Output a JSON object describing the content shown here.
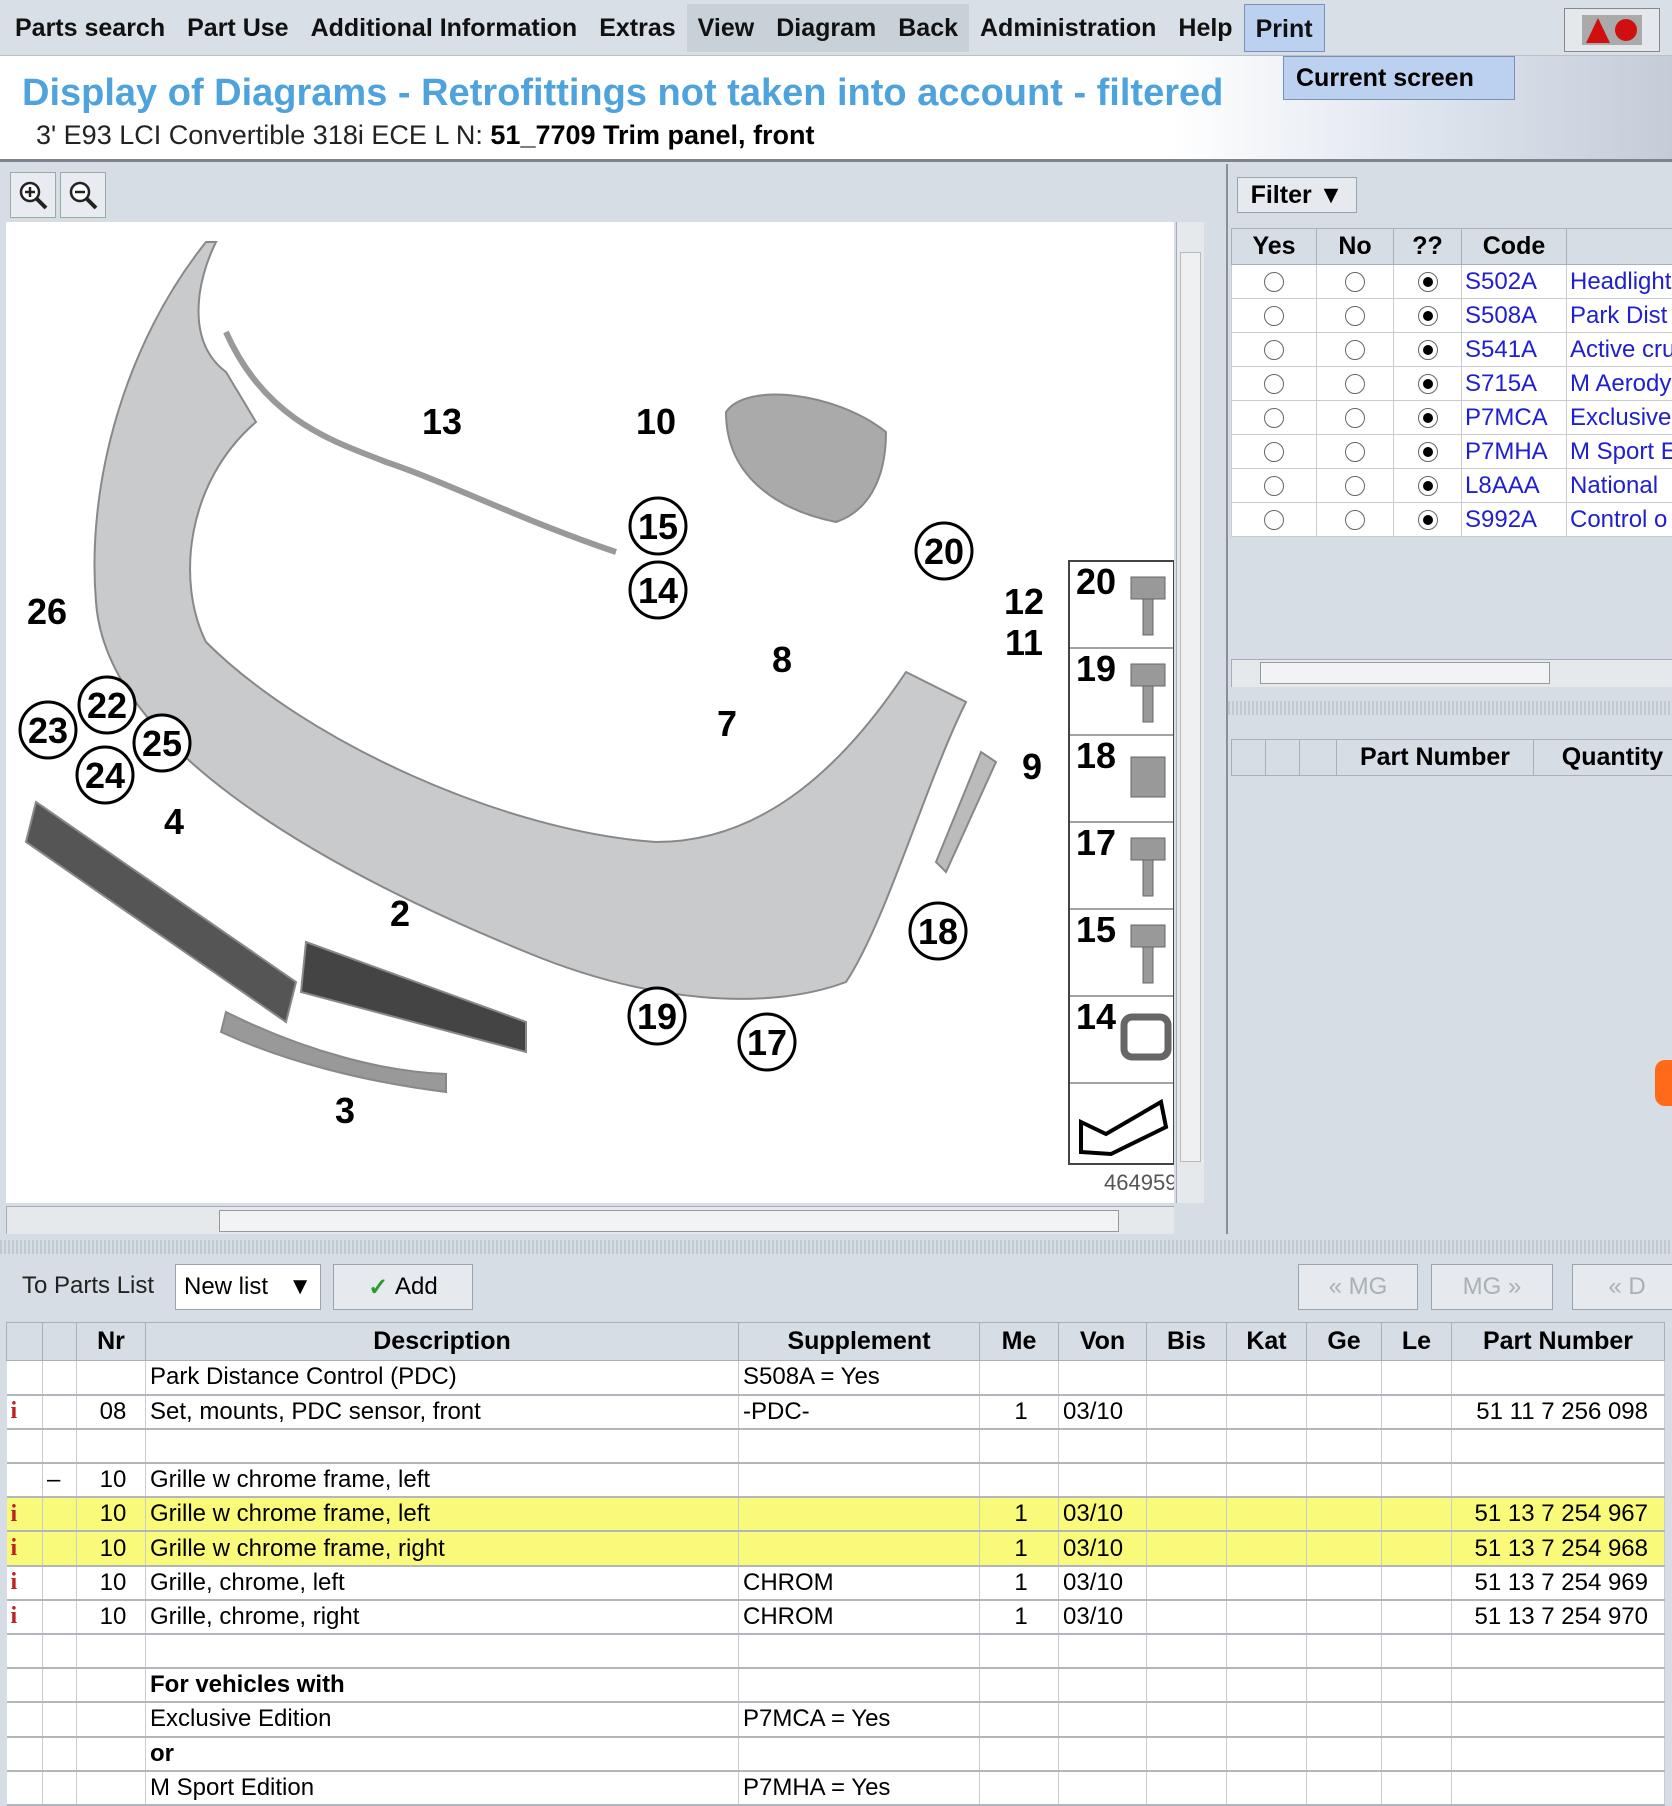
{
  "menu": [
    "Parts search",
    "Part Use",
    "Additional Information",
    "Extras",
    "View",
    "Diagram",
    "Back",
    "Administration",
    "Help",
    "Print"
  ],
  "print_menu": {
    "items": [
      "Current screen"
    ]
  },
  "header": {
    "title": "Display of Diagrams - Retrofittings not taken into account - filtered",
    "vehicle": "3' E93 LCI Convertible 318i ECE  L N:",
    "group": "51_7709 Trim panel, front"
  },
  "diagram": {
    "image_id": "464959",
    "callouts": [
      "13",
      "10",
      "15",
      "14",
      "20",
      "12",
      "11",
      "8",
      "7",
      "9",
      "26",
      "22",
      "23",
      "25",
      "24",
      "4",
      "2",
      "18",
      "19",
      "17",
      "3"
    ],
    "strip": [
      "20",
      "19",
      "18",
      "17",
      "15",
      "14"
    ]
  },
  "filter": {
    "button": "Filter",
    "headers": [
      "Yes",
      "No",
      "??",
      "Code",
      ""
    ],
    "rows": [
      {
        "code": "S502A",
        "desc": "Headlight",
        "sel": "??"
      },
      {
        "code": "S508A",
        "desc": "Park Dist",
        "sel": "??"
      },
      {
        "code": "S541A",
        "desc": "Active cru",
        "sel": "??"
      },
      {
        "code": "S715A",
        "desc": "M Aerody",
        "sel": "??"
      },
      {
        "code": "P7MCA",
        "desc": "Exclusive",
        "sel": "??"
      },
      {
        "code": "P7MHA",
        "desc": "M Sport E",
        "sel": "??"
      },
      {
        "code": "L8AAA",
        "desc": "National",
        "sel": "??"
      },
      {
        "code": "S992A",
        "desc": "Control o",
        "sel": "??"
      }
    ]
  },
  "parts_list_panel": {
    "headers": [
      "",
      "",
      "",
      "Part Number",
      "Quantity"
    ]
  },
  "toolbar": {
    "to_parts_list": "To Parts List",
    "list_select": "New list",
    "add": "Add",
    "prev_mg": "« MG",
    "next_mg": "MG »",
    "prev_d": "« D"
  },
  "colors": {
    "title": "#4fa3dc",
    "highlight": "#fafa7a",
    "link": "#2020d0"
  },
  "parts": {
    "headers": [
      "",
      "",
      "Nr",
      "Description",
      "Supplement",
      "Me",
      "Von",
      "Bis",
      "Kat",
      "Ge",
      "Le",
      "Part Number"
    ],
    "rows": [
      {
        "i": "",
        "m": "",
        "nr": "",
        "desc": "Park Distance Control (PDC)",
        "supp": "S508A = Yes",
        "me": "",
        "von": "",
        "pn": "",
        "hl": false,
        "bold": false
      },
      {
        "i": "i",
        "m": "",
        "nr": "08",
        "desc": "Set, mounts, PDC sensor, front",
        "supp": "-PDC-",
        "me": "1",
        "von": "03/10",
        "pn": "51 11 7 256 098",
        "hl": false,
        "bold": false
      },
      {
        "i": "",
        "m": "",
        "nr": "",
        "desc": "",
        "supp": "",
        "me": "",
        "von": "",
        "pn": "",
        "hl": false,
        "bold": false
      },
      {
        "i": "",
        "m": "–",
        "nr": "10",
        "desc": "Grille w chrome frame, left",
        "supp": "",
        "me": "",
        "von": "",
        "pn": "",
        "hl": false,
        "bold": false
      },
      {
        "i": "i",
        "m": "",
        "nr": "10",
        "desc": "Grille w chrome frame, left",
        "supp": "",
        "me": "1",
        "von": "03/10",
        "pn": "51 13 7 254 967",
        "hl": true,
        "bold": false
      },
      {
        "i": "i",
        "m": "",
        "nr": "10",
        "desc": "Grille w chrome frame, right",
        "supp": "",
        "me": "1",
        "von": "03/10",
        "pn": "51 13 7 254 968",
        "hl": true,
        "bold": false
      },
      {
        "i": "i",
        "m": "",
        "nr": "10",
        "desc": "Grille, chrome, left",
        "supp": "CHROM",
        "me": "1",
        "von": "03/10",
        "pn": "51 13 7 254 969",
        "hl": false,
        "bold": false
      },
      {
        "i": "i",
        "m": "",
        "nr": "10",
        "desc": "Grille, chrome, right",
        "supp": "CHROM",
        "me": "1",
        "von": "03/10",
        "pn": "51 13 7 254 970",
        "hl": false,
        "bold": false
      },
      {
        "i": "",
        "m": "",
        "nr": "",
        "desc": "",
        "supp": "",
        "me": "",
        "von": "",
        "pn": "",
        "hl": false,
        "bold": false
      },
      {
        "i": "",
        "m": "",
        "nr": "",
        "desc": "For vehicles with",
        "supp": "",
        "me": "",
        "von": "",
        "pn": "",
        "hl": false,
        "bold": true
      },
      {
        "i": "",
        "m": "",
        "nr": "",
        "desc": "Exclusive Edition",
        "supp": "P7MCA = Yes",
        "me": "",
        "von": "",
        "pn": "",
        "hl": false,
        "bold": false
      },
      {
        "i": "",
        "m": "",
        "nr": "",
        "desc": "or",
        "supp": "",
        "me": "",
        "von": "",
        "pn": "",
        "hl": false,
        "bold": true
      },
      {
        "i": "",
        "m": "",
        "nr": "",
        "desc": "M Sport Edition",
        "supp": "P7MHA = Yes",
        "me": "",
        "von": "",
        "pn": "",
        "hl": false,
        "bold": false
      }
    ]
  }
}
